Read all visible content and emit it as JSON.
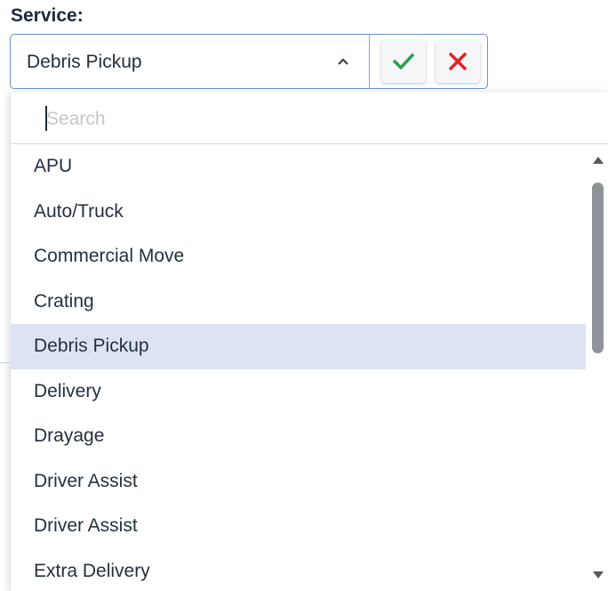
{
  "field": {
    "label": "Service:",
    "selected_value": "Debris Pickup"
  },
  "search": {
    "placeholder": "Search",
    "value": ""
  },
  "actions": {
    "confirm_icon": "check-icon",
    "cancel_icon": "close-icon",
    "confirm_color": "#2e9e57",
    "cancel_color": "#e02424"
  },
  "options": [
    "APU",
    "Auto/Truck",
    "Commercial Move",
    "Crating",
    "Debris Pickup",
    "Delivery",
    "Drayage",
    "Driver Assist",
    "Driver Assist",
    "Extra Delivery"
  ],
  "selected_index": 4,
  "colors": {
    "accent_border": "#6b8fd6",
    "selected_row": "#dde3f2"
  }
}
